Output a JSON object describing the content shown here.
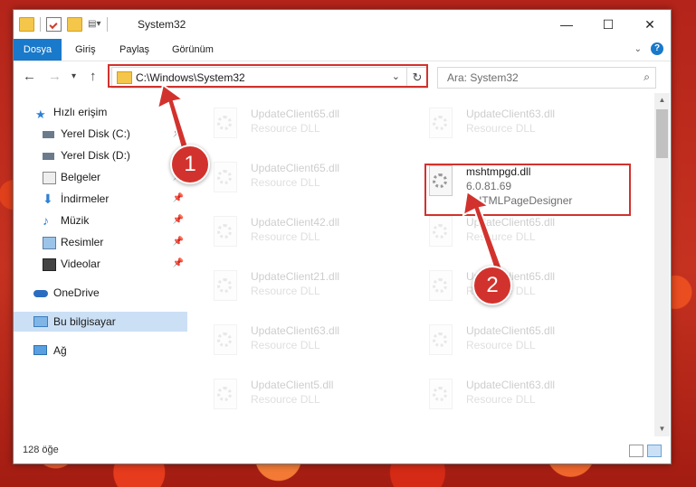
{
  "window": {
    "title": "System32"
  },
  "ribbon": {
    "tabs": [
      "Dosya",
      "Giriş",
      "Paylaş",
      "Görünüm"
    ]
  },
  "navigation": {
    "back": "←",
    "forward": "→",
    "recent": "▾",
    "up": "↑"
  },
  "address": {
    "path": "C:\\Windows\\System32"
  },
  "search": {
    "placeholder": "Ara: System32"
  },
  "sidebar": {
    "items": [
      {
        "label": "Hızlı erişim",
        "icon": "star-icon"
      },
      {
        "label": "Yerel Disk (C:)",
        "icon": "drive-icon",
        "pinned": true
      },
      {
        "label": "Yerel Disk (D:)",
        "icon": "drive-icon",
        "pinned": true
      },
      {
        "label": "Belgeler",
        "icon": "documents-icon",
        "pinned": true
      },
      {
        "label": "İndirmeler",
        "icon": "download-icon",
        "pinned": true
      },
      {
        "label": "Müzik",
        "icon": "music-icon",
        "pinned": true
      },
      {
        "label": "Resimler",
        "icon": "pictures-icon",
        "pinned": true
      },
      {
        "label": "Videolar",
        "icon": "video-icon",
        "pinned": true
      },
      {
        "label": "OneDrive",
        "icon": "cloud-icon"
      },
      {
        "label": "Bu bilgisayar",
        "icon": "computer-icon",
        "selected": true
      },
      {
        "label": "Ağ",
        "icon": "network-icon"
      }
    ]
  },
  "files": [
    {
      "name": "UpdateClient65.dll",
      "desc": "Resource DLL",
      "faded": true
    },
    {
      "name": "UpdateClient63.dll",
      "desc": "Resource DLL",
      "faded": true
    },
    {
      "name": "UpdateClient65.dll",
      "desc": "Resource DLL",
      "faded": true
    },
    {
      "name": "mshtmpgd.dll",
      "desc": "6.0.81.69",
      "desc2": "DHTMLPageDesigner",
      "faded": false
    },
    {
      "name": "UpdateClient42.dll",
      "desc": "Resource DLL",
      "faded": true
    },
    {
      "name": "UpdateClient65.dll",
      "desc": "Resource DLL",
      "faded": true
    },
    {
      "name": "UpdateClient21.dll",
      "desc": "Resource DLL",
      "faded": true
    },
    {
      "name": "UpdateClient65.dll",
      "desc": "Resource DLL",
      "faded": true
    },
    {
      "name": "UpdateClient63.dll",
      "desc": "Resource DLL",
      "faded": true
    },
    {
      "name": "UpdateClient65.dll",
      "desc": "Resource DLL",
      "faded": true
    },
    {
      "name": "UpdateClient5.dll",
      "desc": "Resource DLL",
      "faded": true
    },
    {
      "name": "UpdateClient63.dll",
      "desc": "Resource DLL",
      "faded": true
    }
  ],
  "status": {
    "item_count": "128 öğe"
  },
  "callouts": {
    "first": "1",
    "second": "2"
  },
  "colors": {
    "accent": "#1979ca",
    "highlight": "#d2322d",
    "selected": "#cce0f5"
  }
}
